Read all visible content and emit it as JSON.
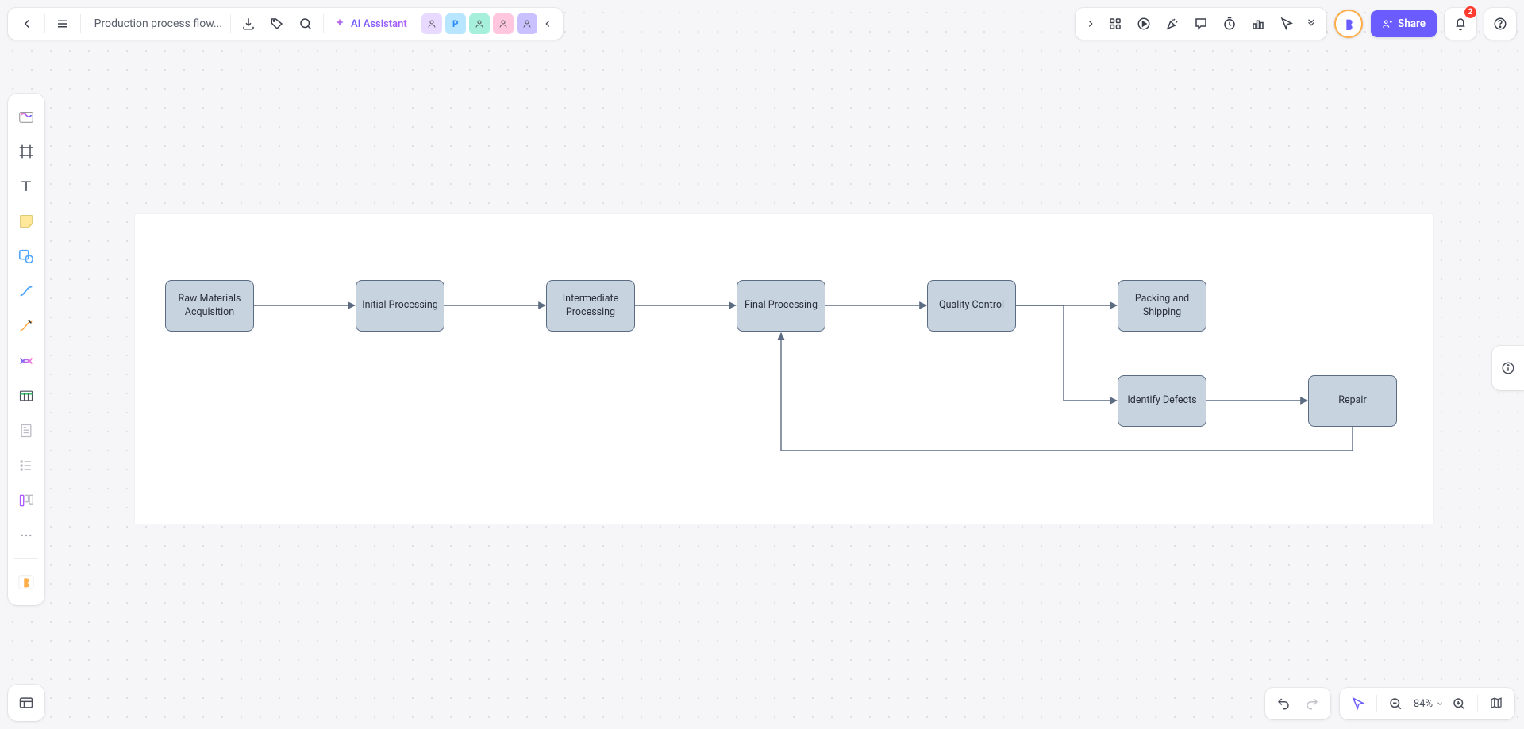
{
  "header": {
    "doc_title": "Production process flow...",
    "ai_label": "AI Assistant",
    "share_label": "Share",
    "notification_count": "2"
  },
  "zoom": {
    "level": "84%"
  },
  "collab_chips": [
    {
      "initial": "",
      "bg": "#e7d9ff"
    },
    {
      "initial": "P",
      "bg": "#b8e5ff",
      "color": "#2b8bff"
    },
    {
      "initial": "",
      "bg": "#a6f0db"
    },
    {
      "initial": "",
      "bg": "#ffc6de"
    },
    {
      "initial": "",
      "bg": "#c8c0ff"
    }
  ],
  "diagram": {
    "nodes": {
      "raw": "Raw Materials Acquisition",
      "init": "Initial Processing",
      "inter": "Intermediate Processing",
      "final": "Final Processing",
      "qc": "Quality Control",
      "pack": "Packing and Shipping",
      "defect": "Identify Defects",
      "repair": "Repair"
    }
  },
  "chart_data": {
    "type": "flowchart",
    "nodes": [
      {
        "id": "raw",
        "label": "Raw Materials Acquisition"
      },
      {
        "id": "init",
        "label": "Initial Processing"
      },
      {
        "id": "inter",
        "label": "Intermediate Processing"
      },
      {
        "id": "final",
        "label": "Final Processing"
      },
      {
        "id": "qc",
        "label": "Quality Control"
      },
      {
        "id": "pack",
        "label": "Packing and Shipping"
      },
      {
        "id": "defect",
        "label": "Identify Defects"
      },
      {
        "id": "repair",
        "label": "Repair"
      }
    ],
    "edges": [
      {
        "from": "raw",
        "to": "init"
      },
      {
        "from": "init",
        "to": "inter"
      },
      {
        "from": "inter",
        "to": "final"
      },
      {
        "from": "final",
        "to": "qc"
      },
      {
        "from": "qc",
        "to": "pack"
      },
      {
        "from": "qc",
        "to": "defect"
      },
      {
        "from": "defect",
        "to": "repair"
      },
      {
        "from": "repair",
        "to": "final"
      }
    ]
  }
}
